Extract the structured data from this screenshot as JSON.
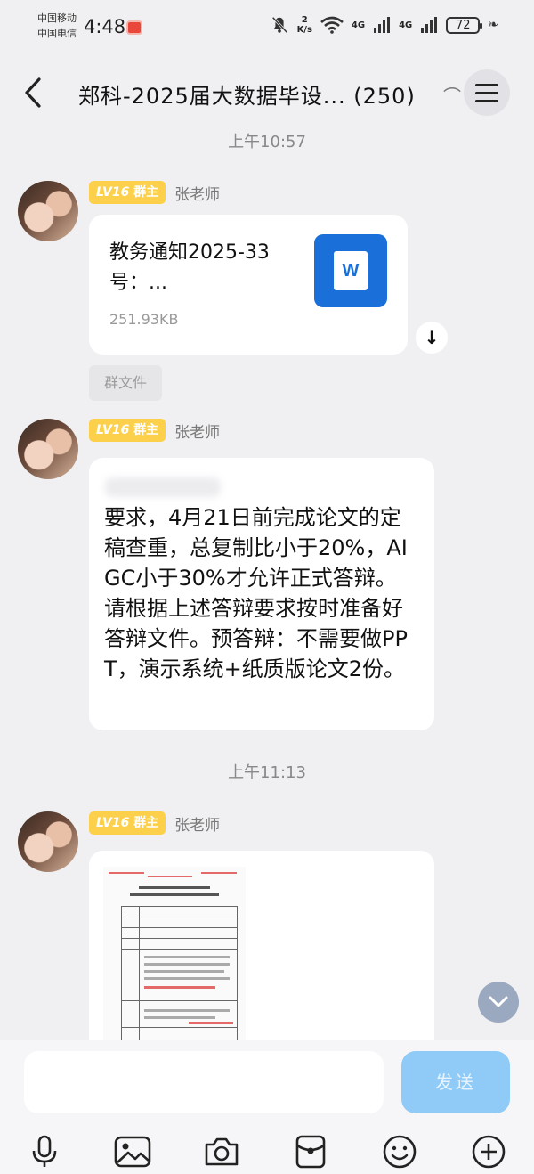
{
  "status_bar": {
    "carrier1": "中国移动",
    "carrier2": "中国电信",
    "time": "4:48",
    "speed_value": "2",
    "speed_unit": "K/s",
    "net1": "4G",
    "net2": "4G",
    "battery": "72",
    "icons": [
      "mute-bell-icon",
      "wifi-icon",
      "signal-icon",
      "battery-icon",
      "leaf-icon"
    ]
  },
  "header": {
    "title": "郑科-2025届大数据毕设...",
    "count": "(250)",
    "icons": [
      "back-arrow-icon",
      "ear-icon",
      "menu-icon"
    ]
  },
  "messages": {
    "time1": "上午10:57",
    "time2": "上午11:13",
    "sender": {
      "level": "LV16",
      "role": "群主",
      "name": "张老师"
    },
    "file": {
      "name": "教务通知2025-33号：...",
      "size": "251.93KB",
      "icon_label": "W",
      "tag": "群文件"
    },
    "text": "要求，4月21日前完成论文的定稿查重，总复制比小于20%，AIGC小于30%才允许正式答辩。请根据上述答辩要求按时准备好答辩文件。预答辩：不需要做PPT，演示系统+纸质版论文2份。"
  },
  "input_bar": {
    "placeholder": "",
    "send_label": "发送",
    "tools": [
      "microphone-icon",
      "image-icon",
      "camera-icon",
      "red-packet-icon",
      "emoji-icon",
      "plus-icon"
    ]
  },
  "colors": {
    "background": "#f0f0f2",
    "badge": "#fcd04a",
    "send_button": "#8fcbf6",
    "word_blue": "#1a6fd8"
  }
}
